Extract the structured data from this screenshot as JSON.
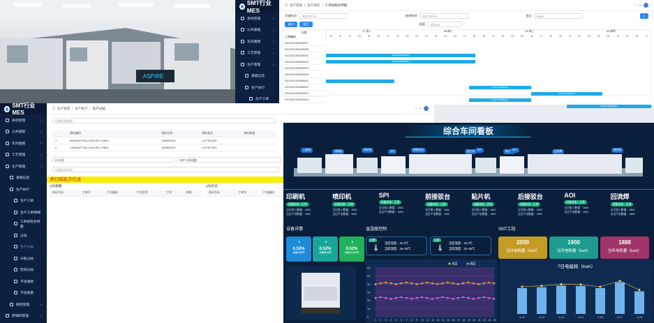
{
  "brand": "SMT行业MES",
  "gantt": {
    "breadcrumb": [
      "生产管理",
      "生产排程",
      "工单排程甘特图"
    ],
    "start_label": "开始时间",
    "start_value": "2020-01-01",
    "end_label": "结束时间",
    "end_value": "2021-05-06",
    "view_label": "显示",
    "view_value": "Week",
    "scale_label": "刻度",
    "scale_value": "3/hours",
    "btn1": "缩小",
    "btn2": "放大",
    "day_label": "日期",
    "wo_label": "工单编码",
    "days": [
      "27-周一",
      "28-周二",
      "29-周三",
      "30-周四"
    ],
    "hours": [
      "18",
      "21",
      "24",
      "03",
      "06",
      "09",
      "12",
      "15",
      "18",
      "21",
      "24",
      "03",
      "06",
      "09",
      "12",
      "15",
      "18",
      "21",
      "24",
      "03",
      "06",
      "09",
      "12",
      "15",
      "18",
      "21",
      "24",
      "03",
      "06",
      "09",
      "12",
      "15",
      "18",
      "21"
    ],
    "rows": [
      "SCGD2105240007",
      "SCGD2105240005",
      "SCGD2105250001",
      "SCGD2105250003",
      "SCGD2105250004",
      "SCGD2105250005",
      "SCGD2105260001",
      "SCGD2105260002",
      "SCGD2105260003",
      "SCGD2105260004"
    ],
    "bar_label": "U5214100000010"
  },
  "menu_top": [
    "系统管理",
    "公共基础",
    "车间建模",
    "工艺管理",
    "生产管理",
    "基础信息",
    "生产执行",
    "生产工单"
  ],
  "menu_main": [
    "系统管理",
    "公共基础",
    "车间建模",
    "工艺管理",
    "生产管理",
    "基础信息",
    "生产执行",
    "生产工单",
    "生产工单明细",
    "工单排程甘特图",
    "过站",
    "生产过站",
    "分板过站",
    "检测过站",
    "不良维修",
    "不良报废",
    "质检管理",
    "原辅料管理"
  ],
  "trace": {
    "breadcrumb": [
      "生产管理",
      "生产执行",
      "生产过站"
    ],
    "scan_placeholder": "扫描条码信息",
    "cols": [
      "物料编码",
      "物料名称",
      "物料批次",
      "物料数量"
    ],
    "rows": [
      [
        "BKSD(ATTN)-U10K-EK-0.9603",
        "100000109",
        "LOT307003"
      ],
      [
        "CKSD(ATTN)-U10K-EK-0.9603",
        "100000109",
        "LOT307003"
      ]
    ],
    "sel1": "DA1线",
    "sel2": "SMT-3条线路",
    "scan2": "扫描条码信息",
    "banner": "请扫描批次信息",
    "left_title": "过站数量",
    "right_title": "过站历史",
    "lcols": [
      "条码号码",
      "工单号",
      "产品编码",
      "产品名称",
      "工序",
      "结果"
    ],
    "rcols": [
      "条码号码",
      "工单号",
      "产品编码"
    ]
  },
  "dash": {
    "title": "综合车间看板",
    "stations": [
      "上板机",
      "印刷机",
      "喷印机",
      "SPI",
      "前接驳台",
      "贴片机",
      "SPI",
      "贴片机",
      "AOI",
      "回流焊",
      "接驳机"
    ],
    "equip": [
      {
        "name": "印刷机",
        "status": "设备状态：正常",
        "in": "当日投入数量：1800",
        "out": "当日产出数量：1800"
      },
      {
        "name": "喷印机",
        "status": "设备状态：正常",
        "in": "当日投入数量：1800",
        "out": "当日产出数量：1800"
      },
      {
        "name": "SPI",
        "status": "设备状态：正常",
        "in": "当日投入数量：1800",
        "out": "当日产出数量：1800"
      },
      {
        "name": "前接驳台",
        "status": "设备状态：正常",
        "in": "当日投入数量：1800",
        "out": "当日产出数量：1800"
      },
      {
        "name": "贴片机",
        "status": "设备状态：正常",
        "in": "当日投入数量：1800",
        "out": "当日产出数量：1800"
      },
      {
        "name": "后接驳台",
        "status": "设备状态：正常",
        "in": "当日投入数量：1800",
        "out": "当日产出数量：1800"
      },
      {
        "name": "AOI",
        "status": "设备状态：正常",
        "in": "当日投入数量：1800",
        "out": "当日产出数量：1800"
      },
      {
        "name": "回流焊",
        "status": "设备状态：正常",
        "in": "当日投入数量：1800",
        "out": "当日产出数量：1800"
      }
    ],
    "sec_detail": "设备详情",
    "sec_temp": "温湿度控制",
    "sec_smt": "SMT工段",
    "gauges": [
      {
        "v": "0.52%",
        "t": "设备利用率"
      },
      {
        "v": "0.52%",
        "t": "设备稼动率"
      },
      {
        "v": "0.52%",
        "t": "设备综合效率"
      }
    ],
    "temps": [
      {
        "tag": "正常",
        "t": "当前温度：22.8℃",
        "h": "当前湿度：18~28℃"
      },
      {
        "tag": "正常",
        "t": "当前温度：22.8℃",
        "h": "当前湿度：18~28℃"
      }
    ],
    "kpis": [
      {
        "v": "2000",
        "t": "当日电耗量（kwh）",
        "c": "#c49b25"
      },
      {
        "v": "1900",
        "t": "当月电耗量（kwh）",
        "c": "#1f9a8f"
      },
      {
        "v": "1888",
        "t": "当年电耗量（kwh）",
        "c": "#a0336a"
      }
    ],
    "legend_east": "东区",
    "legend_west": "西区",
    "line_y": [
      "60",
      "50",
      "40",
      "30",
      "20",
      "10",
      "0"
    ],
    "energy_title": "7日电能耗（kwh）",
    "energy_x": [
      "4-12",
      "4-13",
      "4-14",
      "4-15",
      "4-16",
      "4-17",
      "4-18"
    ]
  },
  "chart_data": [
    {
      "type": "line",
      "title": "",
      "x": [
        "1",
        "2",
        "3",
        "4",
        "5",
        "6",
        "7",
        "8",
        "9",
        "10",
        "11",
        "12",
        "13",
        "14",
        "15",
        "16",
        "17",
        "18",
        "19",
        "20",
        "21",
        "22",
        "23",
        "24"
      ],
      "series": [
        {
          "name": "东区",
          "values": [
            40,
            41,
            42,
            41,
            40,
            41,
            42,
            41,
            40,
            41,
            42,
            41,
            40,
            41,
            42,
            41,
            40,
            41,
            42,
            41,
            40,
            41,
            42,
            41
          ]
        },
        {
          "name": "西区",
          "values": [
            23,
            24,
            23,
            22,
            23,
            24,
            23,
            22,
            23,
            24,
            23,
            22,
            23,
            24,
            23,
            22,
            23,
            24,
            23,
            22,
            23,
            24,
            23,
            22
          ]
        }
      ],
      "ylim": [
        0,
        60
      ],
      "legend": "top-right"
    },
    {
      "type": "bar",
      "title": "7日电能耗（kwh）",
      "categories": [
        "4-12",
        "4-13",
        "4-14",
        "4-15",
        "4-16",
        "4-17",
        "4-18"
      ],
      "values": [
        640,
        660,
        700,
        690,
        640,
        780,
        560
      ],
      "ylim": [
        0,
        1000
      ]
    }
  ]
}
